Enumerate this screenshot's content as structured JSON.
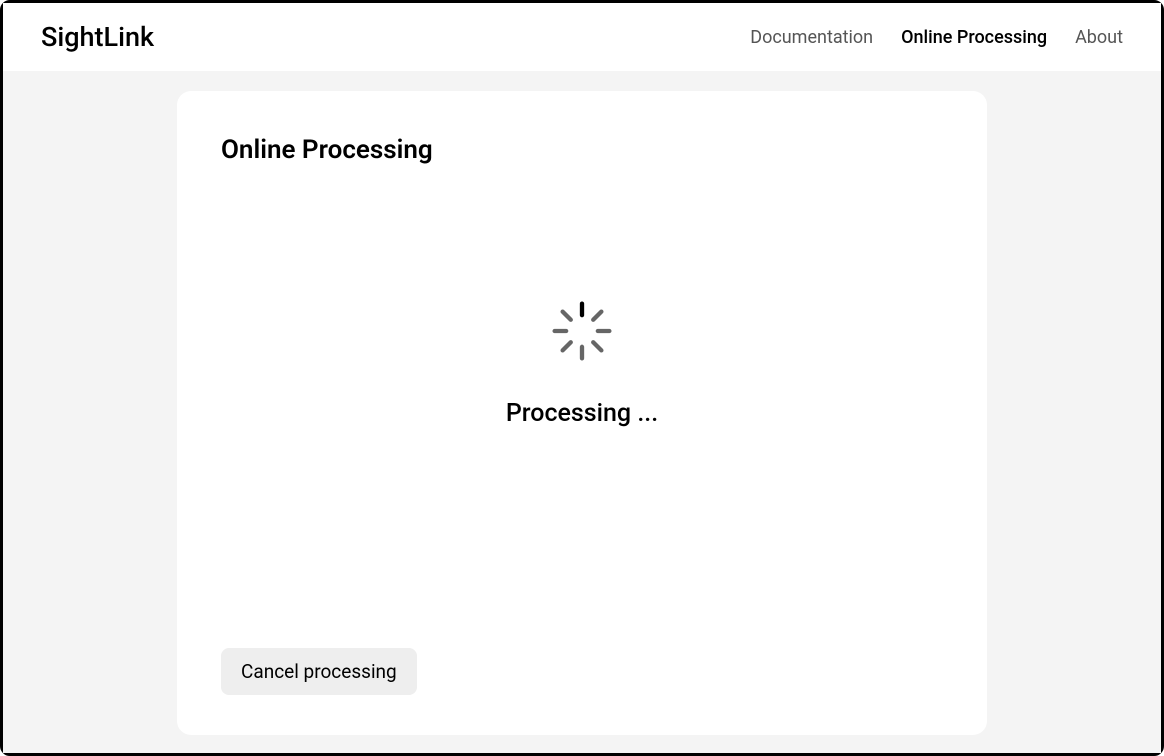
{
  "header": {
    "logo": "SightLink",
    "nav": [
      {
        "label": "Documentation",
        "active": false
      },
      {
        "label": "Online Processing",
        "active": true
      },
      {
        "label": "About",
        "active": false
      }
    ]
  },
  "card": {
    "title": "Online Processing",
    "status_text": "Processing ...",
    "cancel_label": "Cancel processing"
  }
}
